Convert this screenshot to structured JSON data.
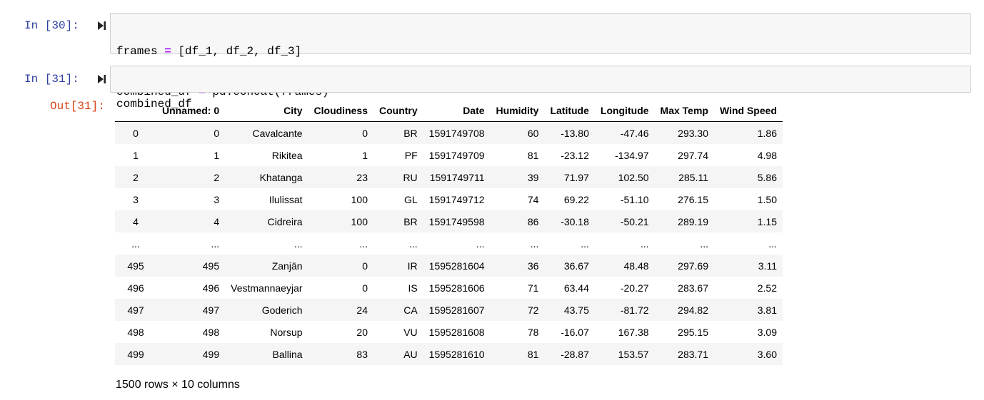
{
  "cells": [
    {
      "prompt": "In [30]:",
      "code_lines": [
        [
          "frames ",
          "=",
          " [df_1, df_2, df_3]"
        ],
        [
          "combined_df ",
          "=",
          " pd.concat(frames)"
        ]
      ]
    },
    {
      "prompt": "In [31]:",
      "code_lines": [
        [
          "combined_df",
          "",
          ""
        ]
      ],
      "out_prompt": "Out[31]:"
    }
  ],
  "table": {
    "columns": [
      "",
      "Unnamed: 0",
      "City",
      "Cloudiness",
      "Country",
      "Date",
      "Humidity",
      "Latitude",
      "Longitude",
      "Max Temp",
      "Wind Speed"
    ],
    "rows": [
      [
        "0",
        "0",
        "Cavalcante",
        "0",
        "BR",
        "1591749708",
        "60",
        "-13.80",
        "-47.46",
        "293.30",
        "1.86"
      ],
      [
        "1",
        "1",
        "Rikitea",
        "1",
        "PF",
        "1591749709",
        "81",
        "-23.12",
        "-134.97",
        "297.74",
        "4.98"
      ],
      [
        "2",
        "2",
        "Khatanga",
        "23",
        "RU",
        "1591749711",
        "39",
        "71.97",
        "102.50",
        "285.11",
        "5.86"
      ],
      [
        "3",
        "3",
        "Ilulissat",
        "100",
        "GL",
        "1591749712",
        "74",
        "69.22",
        "-51.10",
        "276.15",
        "1.50"
      ],
      [
        "4",
        "4",
        "Cidreira",
        "100",
        "BR",
        "1591749598",
        "86",
        "-30.18",
        "-50.21",
        "289.19",
        "1.15"
      ],
      [
        "...",
        "...",
        "...",
        "...",
        "...",
        "...",
        "...",
        "...",
        "...",
        "...",
        "..."
      ],
      [
        "495",
        "495",
        "Zanjān",
        "0",
        "IR",
        "1595281604",
        "36",
        "36.67",
        "48.48",
        "297.69",
        "3.11"
      ],
      [
        "496",
        "496",
        "Vestmannaeyjar",
        "0",
        "IS",
        "1595281606",
        "71",
        "63.44",
        "-20.27",
        "283.67",
        "2.52"
      ],
      [
        "497",
        "497",
        "Goderich",
        "24",
        "CA",
        "1595281607",
        "72",
        "43.75",
        "-81.72",
        "294.82",
        "3.81"
      ],
      [
        "498",
        "498",
        "Norsup",
        "20",
        "VU",
        "1595281608",
        "78",
        "-16.07",
        "167.38",
        "295.15",
        "3.09"
      ],
      [
        "499",
        "499",
        "Ballina",
        "83",
        "AU",
        "1595281610",
        "81",
        "-28.87",
        "153.57",
        "283.71",
        "3.60"
      ]
    ],
    "shape_note": "1500 rows × 10 columns"
  },
  "icons": {
    "run": "step-forward-icon"
  },
  "colors": {
    "in_prompt": "#303f9f",
    "out_prompt": "#d84315",
    "operator": "#aa22ff"
  }
}
